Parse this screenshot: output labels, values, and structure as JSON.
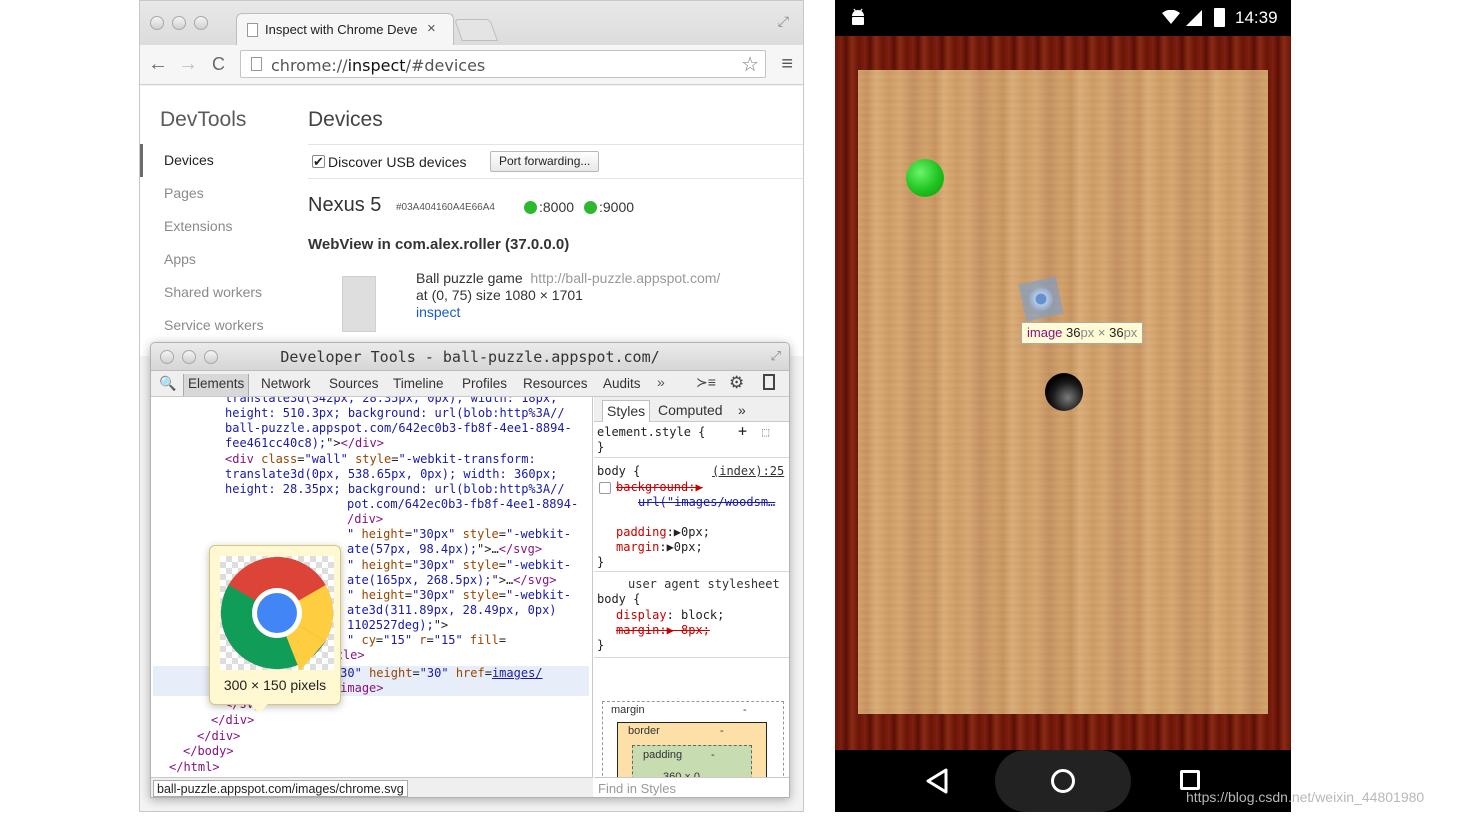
{
  "browser": {
    "tab_title": "Inspect with Chrome Deve",
    "tab_close": "×",
    "url_scheme": "chrome://",
    "url_host": "inspect",
    "url_path": "/#devices",
    "back": "←",
    "forward": "→",
    "reload": "C",
    "star": "☆",
    "menu": "≡",
    "fullscreen": "⤢"
  },
  "inspect_page": {
    "sidebar_title": "DevTools",
    "sidebar_items": [
      "Devices",
      "Pages",
      "Extensions",
      "Apps",
      "Shared workers",
      "Service workers"
    ],
    "main_title": "Devices",
    "discover_checkbox": "✔",
    "discover_label": "Discover USB devices",
    "port_forwarding_button": "Port forwarding...",
    "device_name": "Nexus 5",
    "device_serial": "#03A404160A4E66A4",
    "ports": [
      ":8000",
      ":9000"
    ],
    "webview_title": "WebView in com.alex.roller (37.0.0.0)",
    "page_name": "Ball puzzle game",
    "page_url": "http://ball-puzzle.appspot.com/",
    "page_position": "at (0, 75)  size 1080 × 1701",
    "inspect_link": "inspect"
  },
  "devtools": {
    "title": "Developer Tools - ball-puzzle.appspot.com/",
    "tabs": [
      "Elements",
      "Network",
      "Sources",
      "Timeline",
      "Profiles",
      "Resources",
      "Audits"
    ],
    "more": "»",
    "search_icon_glyph": "🔍",
    "console_icon_glyph": "≻≡",
    "gear_icon_glyph": "⚙",
    "image_preview_size": "300 × 150 pixels",
    "breadcrumb": "ball-puzzle.appspot.com/images/chrome.svg",
    "styles_tabs": [
      "Styles",
      "Computed"
    ],
    "styles_more": "»",
    "find_in_styles": "Find in Styles",
    "box_labels": {
      "margin": "margin",
      "border": "border",
      "padding": "padding",
      "dash": "-",
      "content": "360 × 0"
    }
  },
  "phone": {
    "clock": "14:39",
    "tooltip_tag": "image",
    "tooltip_width": "36",
    "tooltip_height": "36",
    "tooltip_unit": "px",
    "tooltip_times": "×"
  },
  "watermark": "https://blog.csdn.net/weixin_44801980"
}
